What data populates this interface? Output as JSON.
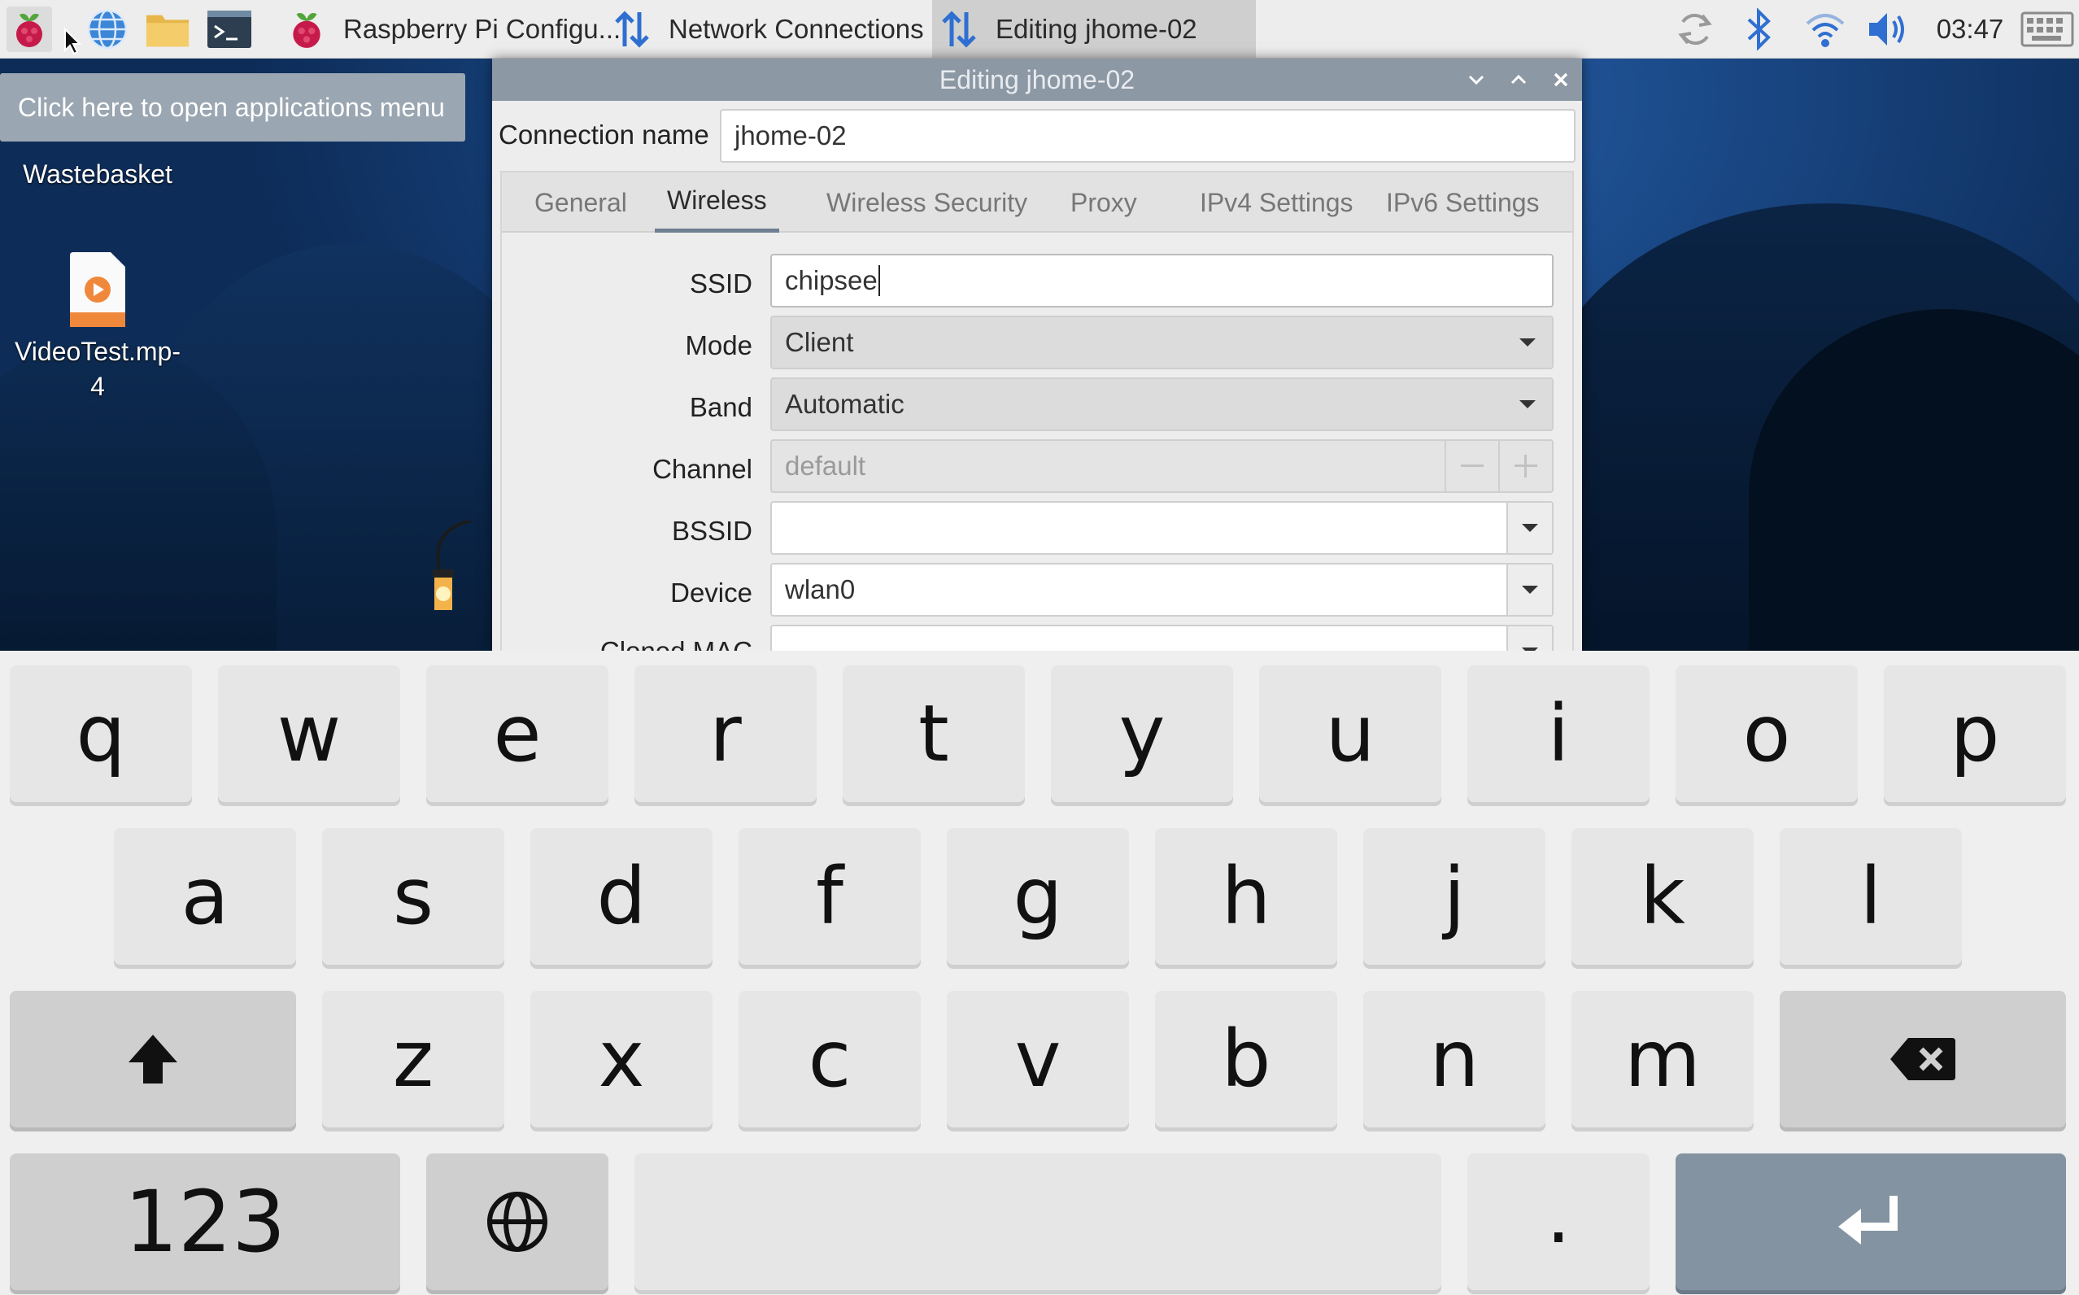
{
  "taskbar": {
    "tasks": [
      {
        "label": "Raspberry Pi Configu...",
        "icon": "raspberry-icon"
      },
      {
        "label": "Network Connections",
        "icon": "network-arrows-icon"
      },
      {
        "label": "Editing jhome-02",
        "icon": "network-arrows-icon"
      }
    ],
    "clock": "03:47"
  },
  "tooltip": "Click here to open applications menu",
  "desktop": {
    "icons": [
      {
        "label": "Wastebasket"
      },
      {
        "label_line1": "VideoTest.mp-",
        "label_line2": "4"
      }
    ]
  },
  "dialog": {
    "title": "Editing jhome-02",
    "connection_name_label": "Connection name",
    "connection_name_value": "jhome-02",
    "tabs": [
      "General",
      "Wireless",
      "Wireless Security",
      "Proxy",
      "IPv4 Settings",
      "IPv6 Settings"
    ],
    "selected_tab": "Wireless",
    "fields": {
      "ssid_label": "SSID",
      "ssid_value": "chipsee",
      "mode_label": "Mode",
      "mode_value": "Client",
      "band_label": "Band",
      "band_value": "Automatic",
      "channel_label": "Channel",
      "channel_value": "default",
      "bssid_label": "BSSID",
      "bssid_value": "",
      "device_label": "Device",
      "device_value": "wlan0",
      "cloned_mac_label": "Cloned MAC address"
    }
  },
  "keyboard": {
    "row1": [
      "q",
      "w",
      "e",
      "r",
      "t",
      "y",
      "u",
      "i",
      "o",
      "p"
    ],
    "row2": [
      "a",
      "s",
      "d",
      "f",
      "g",
      "h",
      "j",
      "k",
      "l"
    ],
    "row3": [
      "z",
      "x",
      "c",
      "v",
      "b",
      "n",
      "m"
    ],
    "numbers_key": "123",
    "period_key": "."
  },
  "colors": {
    "title_bar": "#8c98a4",
    "tab_underline": "#6d7f91",
    "enter_key": "#8493a1",
    "bluetooth": "#2f6fd1"
  }
}
